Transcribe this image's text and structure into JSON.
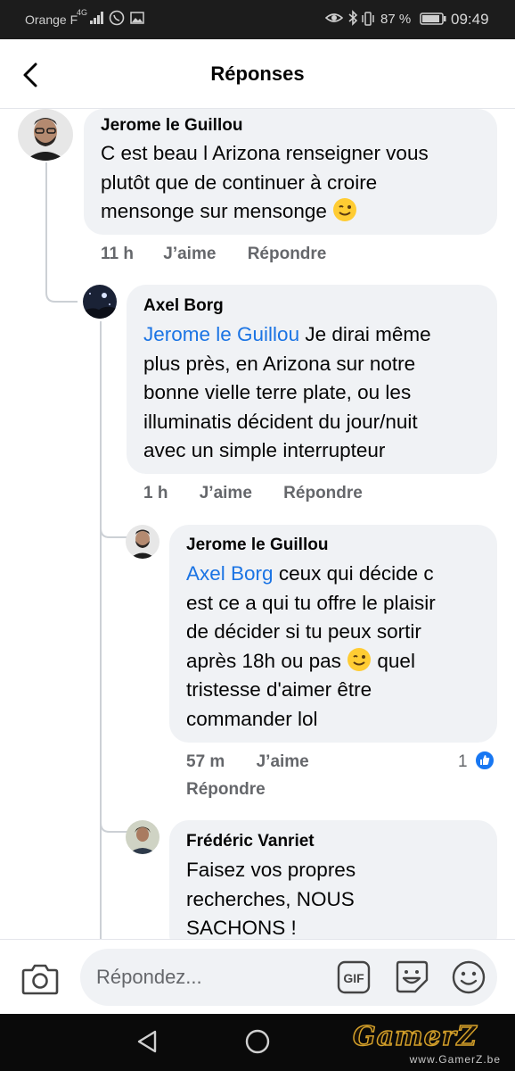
{
  "status_bar": {
    "carrier": "Orange F",
    "network": "4G",
    "battery_percent": "87 %",
    "time": "09:49"
  },
  "header": {
    "title": "Réponses"
  },
  "comments": [
    {
      "author": "Jerome le Guillou",
      "lines": [
        "C est beau l Arizona renseigner vous",
        "plutôt que de continuer à croire",
        "mensonge sur mensonge"
      ],
      "emoji": "wink",
      "time": "11 h",
      "like_label": "J’aime",
      "reply_label": "Répondre"
    },
    {
      "author": "Axel Borg",
      "mention": "Jerome le Guillou",
      "first_line_rest": " Je dirai même",
      "lines": [
        "plus près, en Arizona sur notre",
        "bonne vielle terre plate, ou les",
        "illuminatis décident du jour/nuit",
        "avec un simple interrupteur"
      ],
      "time": "1 h",
      "like_label": "J’aime",
      "reply_label": "Répondre"
    },
    {
      "author": "Jerome le Guillou",
      "mention": "Axel Borg",
      "first_line_rest": " ceux qui décide c",
      "lines": [
        "est ce a qui tu offre le plaisir",
        "de décider si tu peux sortir",
        "après 18h ou pas",
        " quel",
        "tristesse d'aimer être",
        "commander lol"
      ],
      "emoji": "wink",
      "time": "57 m",
      "like_label": "J’aime",
      "reply_label": "Répondre",
      "reactions": "1",
      "reaction_icon": "like-icon",
      "reaction_color": "#1877f2"
    },
    {
      "author": "Frédéric Vanriet",
      "lines": [
        "Faisez vos propres",
        "recherches, NOUS",
        "SACHONS !"
      ]
    }
  ],
  "composer": {
    "placeholder": "Répondez...",
    "gif_label": "GIF"
  },
  "watermark": {
    "logo": "GamerZ",
    "url": "www.GamerZ.be"
  },
  "colors": {
    "mention": "#1b74e4",
    "bubble": "#f0f2f5",
    "meta": "#65676b"
  }
}
